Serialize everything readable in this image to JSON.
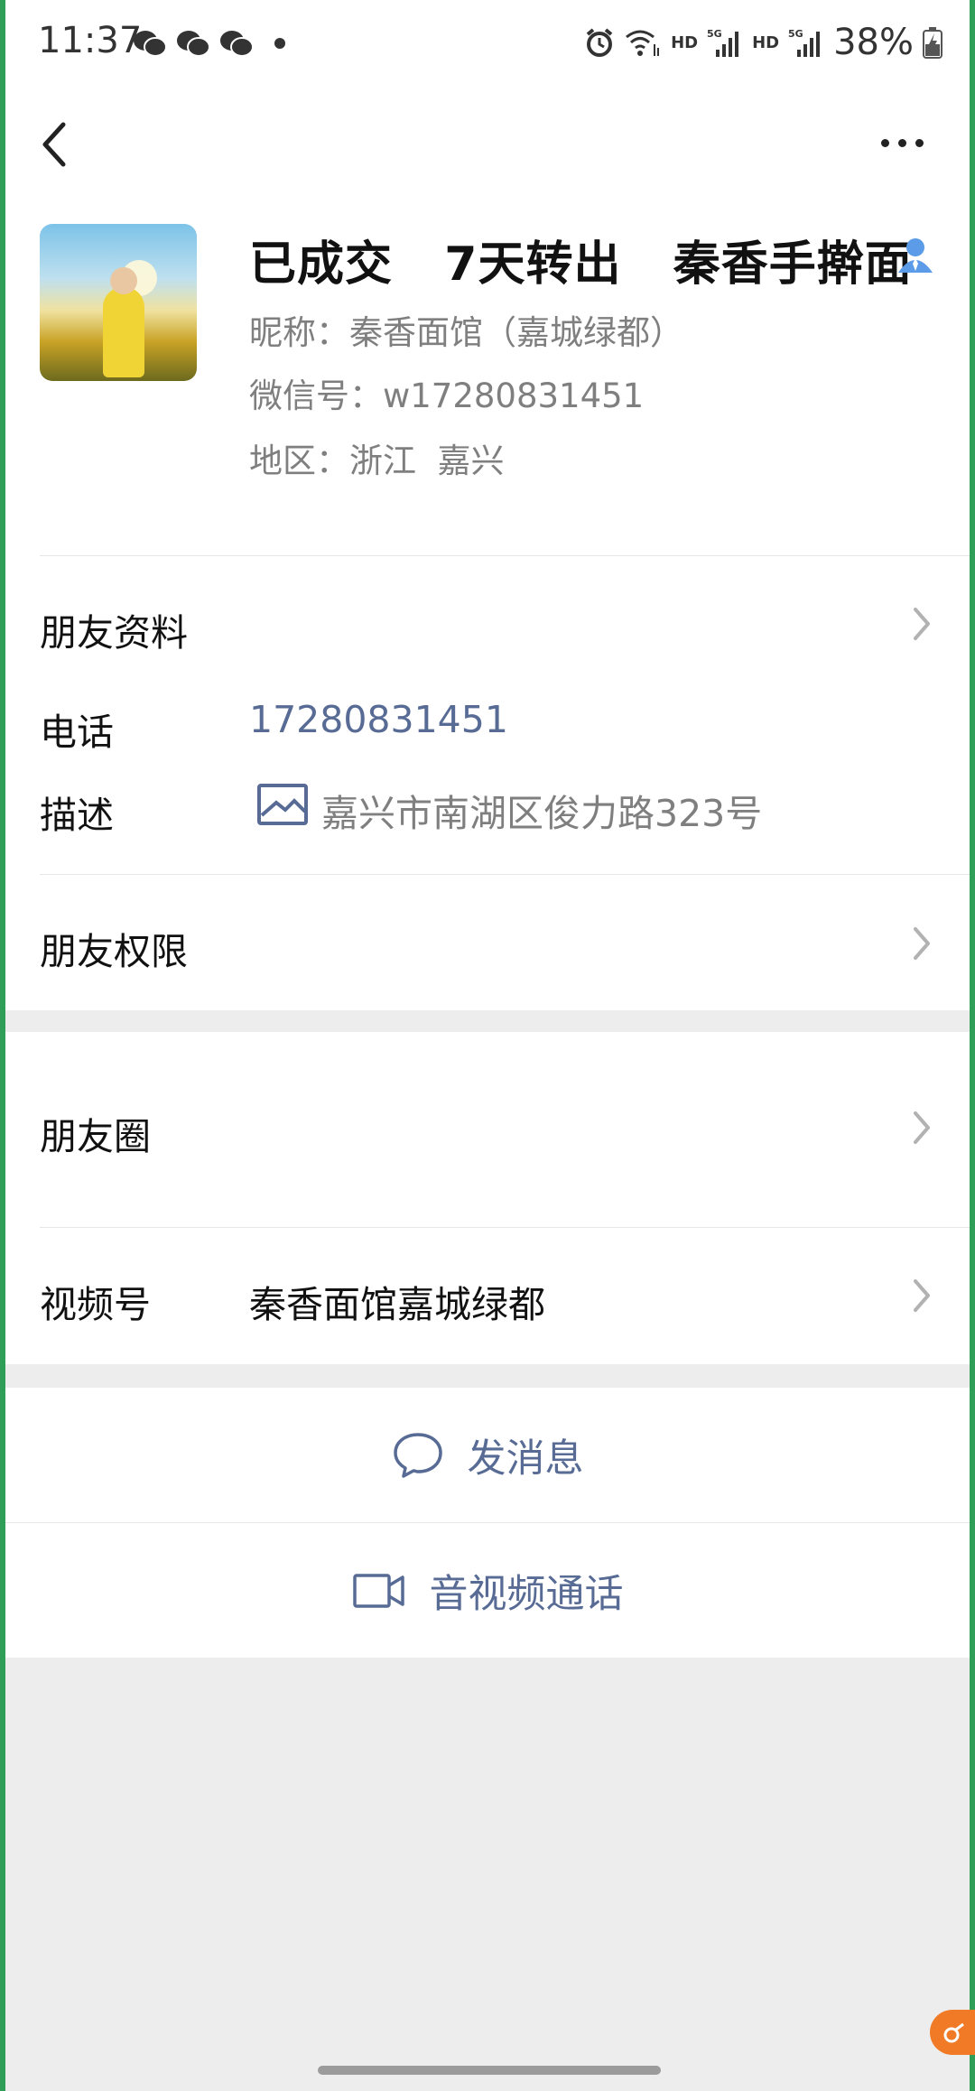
{
  "status_bar": {
    "time": "11:37",
    "hd1": "HD",
    "hd2": "HD",
    "battery": "38%",
    "network": "5G"
  },
  "nav": {
    "back_icon": "chevron-left-icon",
    "more_icon": "more-dots-icon"
  },
  "profile": {
    "name": "已成交   7天转出   秦香手擀面",
    "nickname": "昵称：秦香面馆（嘉城绿都）",
    "wechat_id": "微信号：w17280831451",
    "region": "地区：浙江  嘉兴"
  },
  "details": {
    "friend_info_label": "朋友资料",
    "phone_label": "电话",
    "phone_value": "17280831451",
    "desc_label": "描述",
    "desc_value": "嘉兴市南湖区俊力路323号",
    "permissions_label": "朋友权限"
  },
  "moments": {
    "label": "朋友圈"
  },
  "channels": {
    "label": "视频号",
    "value": "秦香面馆嘉城绿都"
  },
  "actions": {
    "message_label": "发消息",
    "call_label": "音视频通话"
  },
  "colors": {
    "link": "#576b95",
    "border": "#2f9e56",
    "background": "#ededed"
  }
}
